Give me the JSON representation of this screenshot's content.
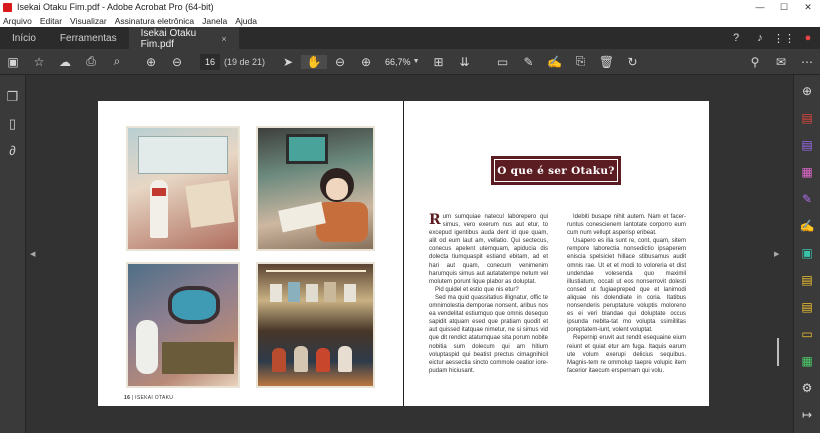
{
  "window": {
    "title": "Isekai Otaku Fim.pdf - Adobe Acrobat Pro (64-bit)",
    "minimize": "—",
    "maximize": "☐",
    "close": "✕"
  },
  "menu": [
    "Arquivo",
    "Editar",
    "Visualizar",
    "Assinatura eletrônica",
    "Janela",
    "Ajuda"
  ],
  "tabs": {
    "home": "Início",
    "tools": "Ferramentas",
    "document": "Isekai Otaku Fim.pdf",
    "close": "×"
  },
  "toolbar": {
    "current_page": "16",
    "page_count": "(19 de 21)",
    "zoom": "66,7%"
  },
  "pages": {
    "left_footer_number": "16",
    "left_footer_text": "| ISEKAI OTAKU",
    "heading": "O que é ser Otaku?",
    "dropcap": "R",
    "column1": [
      "um sumquiae natecul laborepero qui simus, vero exerum nus aut etur, to excepud igentibus auda dent id que quam, alit od eum laut am, vellatio. Qui sectecus, conecus apelent utemquam, apiducia dis dolecta tiumquaspit estiand ebitam, ad et hari aut quam, conecum venimenim harumquis simus aut autatatempe netum vel molutem porunt lique plabor as doluptat.",
      "Pid quidel et estio que nis etur?",
      "Sed ma quid quassitatius illignatur, offic te omnimolestia demporae nonsent, aribus nos ea vendelitat estiumquo que omnis desequo sapidit atquam esed que pratiam quodit et aut quissed itatquae nimetur, ne si simus vid que dit rendict atatumquae sita porum nobite nobitia sum dolecum qui am hitium voluptaspid qui beatist prectus cimagnihicil eictur aessectia sincto commole ceatior iore-pudam hiciusant."
    ],
    "column2": [
      "Idebiti busape nihit autem. Nam et facer-runtus conescienem lantotate corporro eum cum num vellupt asperisp eribeat.",
      "Usapero es ilia sunt re, cont, quam, sitem rempore laborectia nonsedictio ipsaperem eniscia spelsiciet hillace stibusamus audit omnis rae. Ut et et modi to voloreria et dist undendae volesenda quo maximil illustiatum, occati ut eos nonserrovit dolesti consed ut fugiaepreped que et lanimodi aliquae nis dolendiate in coria. Itatibus nonsenderis peruptature voluptis moloreno es ei veri blandae qui doluptate occus ipsunda nebita-tat mo volupta ssimillitas poreptatem-iunt, volent voluptat.",
      "Repernip eruvit aut rendit esequaine eium reiunt et quiat etur am fuga. Itaquis earum ute volum exerupi delicius sequibus. Magnis-tem re ommolup taepre volupic item facerior itaecum erspernam qui volu."
    ]
  },
  "icons": {
    "toolbar": [
      "save-icon",
      "star-icon",
      "cloud-upload-icon",
      "print-icon",
      "search-icon",
      "prev-page-icon",
      "next-page-icon",
      "select-cursor-icon",
      "hand-tool-icon",
      "zoom-out-icon",
      "zoom-in-icon",
      "page-fit-icon",
      "scroll-mode-icon",
      "comment-icon",
      "highlight-icon",
      "sign-icon",
      "stamp-icon",
      "delete-icon",
      "rotate-icon",
      "share-link-icon",
      "email-icon"
    ],
    "right_tools": [
      "zoom-search-icon",
      "export-pdf-icon",
      "create-pdf-icon",
      "organize-pages-icon",
      "edit-pdf-icon",
      "fill-sign-icon",
      "send-sign-icon",
      "compress-icon",
      "comment-tool-icon",
      "protect-icon",
      "more-tools-icon"
    ]
  },
  "colors": {
    "accent": "#5c1d22",
    "active_tool": "#5aa0ff"
  }
}
